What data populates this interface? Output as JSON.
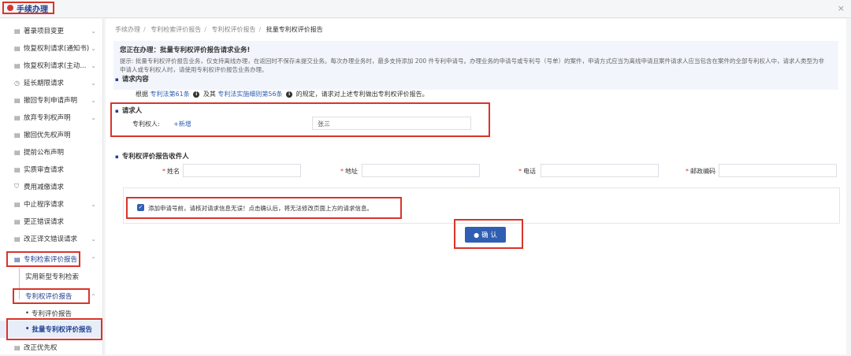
{
  "app": {
    "title": "手续办理",
    "close_glyph": "×",
    "accent_color": "#1f3f8f",
    "highlight_color": "#d9342b"
  },
  "sidebar": {
    "items": [
      {
        "label": "著录项目变更",
        "icon": "doc-icon"
      },
      {
        "label": "恢复权利请求(通知书)",
        "icon": "doc-icon"
      },
      {
        "label": "恢复权利请求(主动...",
        "icon": "doc-icon"
      },
      {
        "label": "延长期限请求",
        "icon": "clock-icon"
      },
      {
        "label": "撤回专利申请声明",
        "icon": "doc-icon"
      },
      {
        "label": "放弃专利权声明",
        "icon": "doc-icon"
      },
      {
        "label": "撤回优先权声明",
        "icon": "doc-icon"
      },
      {
        "label": "提前公布声明",
        "icon": "doc-icon"
      },
      {
        "label": "实质审查请求",
        "icon": "doc-icon"
      },
      {
        "label": "费用减缴请求",
        "icon": "shield-icon"
      },
      {
        "label": "中止程序请求",
        "icon": "doc-icon"
      },
      {
        "label": "更正错误请求",
        "icon": "doc-icon"
      },
      {
        "label": "改正译文错误请求",
        "icon": "doc-icon"
      },
      {
        "label": "专利检索评价报告",
        "icon": "report-icon"
      },
      {
        "label": "实用新型专利检索"
      },
      {
        "label": "专利权评价报告"
      },
      {
        "label": "专利评价报告"
      },
      {
        "label": "批量专利权评价报告"
      },
      {
        "label": "改正优先权",
        "icon": "doc-icon"
      }
    ]
  },
  "breadcrumb": [
    "手续办理",
    "专利检索评价报告",
    "专利权评价报告",
    "批量专利权评价报告"
  ],
  "notice": {
    "title": "您正在办理：批量专利权评价报告请求业务!",
    "hint": "提示: 批量专利权评价报告业务，仅支持离线办理，在返回时不保存未提交业务。每次办理业务时，最多支持添加 200 件专利申请号。办理业务的申请号或专利号（号单）的案件，申请方式应当为离线申请且案件请求人应当包含在案件的全部专利权人中，请求人类型为非申请人或专利权人时，请使用专利权评价报告业务办理。"
  },
  "request_content": {
    "title": "请求内容",
    "basis_prefix": "根据",
    "law_link": "专利法第61条",
    "and_text": "及其",
    "rule_link": "专利法实施细则第56条",
    "basis_suffix": "的规定，请求对上述专利做出专利权评价报告。"
  },
  "requester": {
    "title": "请求人",
    "patentee_label": "专利权人:",
    "add_link": "+新增",
    "patentee_value": "张三"
  },
  "recipient": {
    "title": "专利权评价报告收件人",
    "fields": {
      "name": "姓名",
      "address": "地址",
      "phone": "电话",
      "postcode": "邮政编码"
    }
  },
  "confirm_note": "添加申请号前，请核对请求信息无误！点击确认后，将无法修改页面上方的请求信息。",
  "confirm_checked": true,
  "confirm_button": "确 认"
}
